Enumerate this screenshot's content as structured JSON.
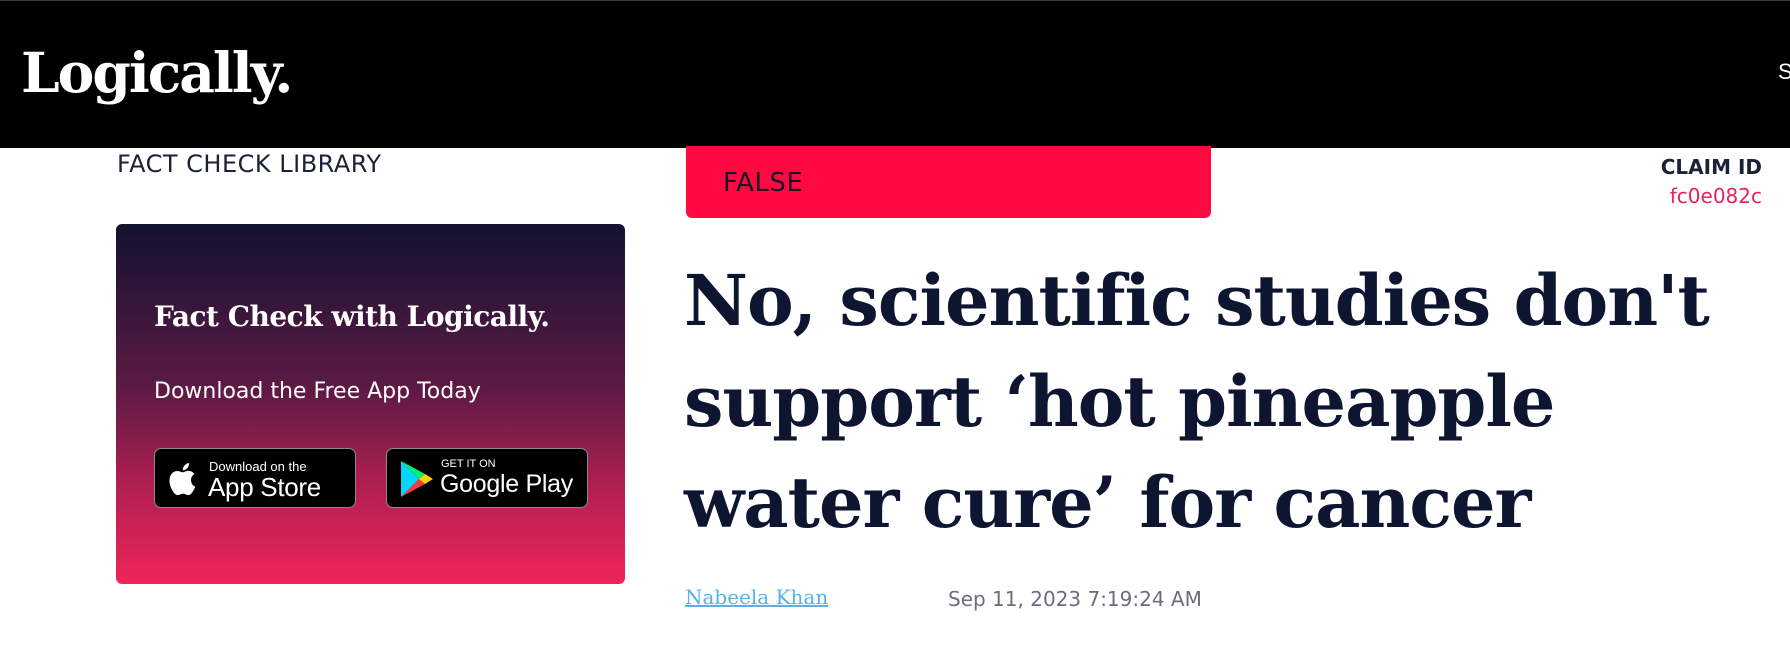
{
  "header": {
    "logo_text": "Logically.",
    "right_text_clipped": "S"
  },
  "sidebar": {
    "heading": "FACT CHECK LIBRARY",
    "promo": {
      "title": "Fact Check with Logically.",
      "subtitle": "Download the Free App Today",
      "app_store": {
        "small": "Download on the",
        "big": "App Store",
        "icon": "apple-icon"
      },
      "google_play": {
        "small": "GET IT ON",
        "big": "Google Play",
        "icon": "google-play-icon"
      }
    }
  },
  "article": {
    "verdict": "FALSE",
    "claim_id_label": "CLAIM ID",
    "claim_id": "fc0e082c",
    "headline": "No, scientific studies don't support ‘hot pineapple water cure’ for cancer",
    "author": "Nabeela Khan",
    "date": "Sep 11, 2023 7:19:24 AM"
  },
  "colors": {
    "verdict_bg": "#ff0a40",
    "claim_id": "#e8235a",
    "author_link": "#4fb3f0",
    "headline": "#0d1530"
  }
}
